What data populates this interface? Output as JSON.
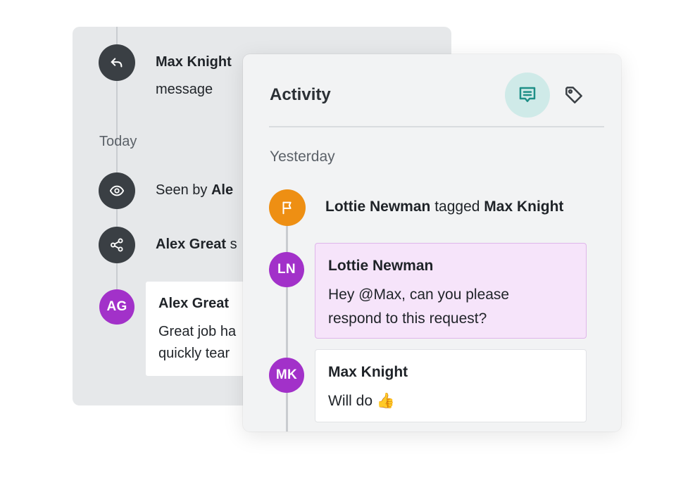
{
  "back_panel": {
    "reply_event": {
      "actor": "Max Knight",
      "rest": "message"
    },
    "date_group": "Today",
    "seen_event": {
      "prefix": "Seen by ",
      "actor": "Ale"
    },
    "share_event": {
      "actor": "Alex Great",
      "rest": " s"
    },
    "comment": {
      "avatar": "AG",
      "author": "Alex Great",
      "lines": [
        "Great job ha",
        "quickly tear"
      ]
    }
  },
  "front_panel": {
    "title": "Activity",
    "tabs": [
      {
        "icon": "chat-icon",
        "active": true
      },
      {
        "icon": "tag-icon",
        "active": false
      }
    ],
    "date_group": "Yesterday",
    "tag_event": {
      "actor": "Lottie Newman",
      "verb": " tagged ",
      "target": "Max Knight"
    },
    "comments": [
      {
        "avatar": "LN",
        "author": "Lottie Newman",
        "text": "Hey @Max, can you please respond to this request?",
        "highlighted": true
      },
      {
        "avatar": "MK",
        "author": "Max Knight",
        "text": "Will do 👍",
        "highlighted": false
      }
    ]
  },
  "colors": {
    "accent_teal": "#1f8f87",
    "avatar_purple": "#a231c9",
    "flag_orange": "#ee8f13",
    "highlight_bg": "#f6e4fa",
    "dark_icon_bg": "#3a3f44"
  }
}
